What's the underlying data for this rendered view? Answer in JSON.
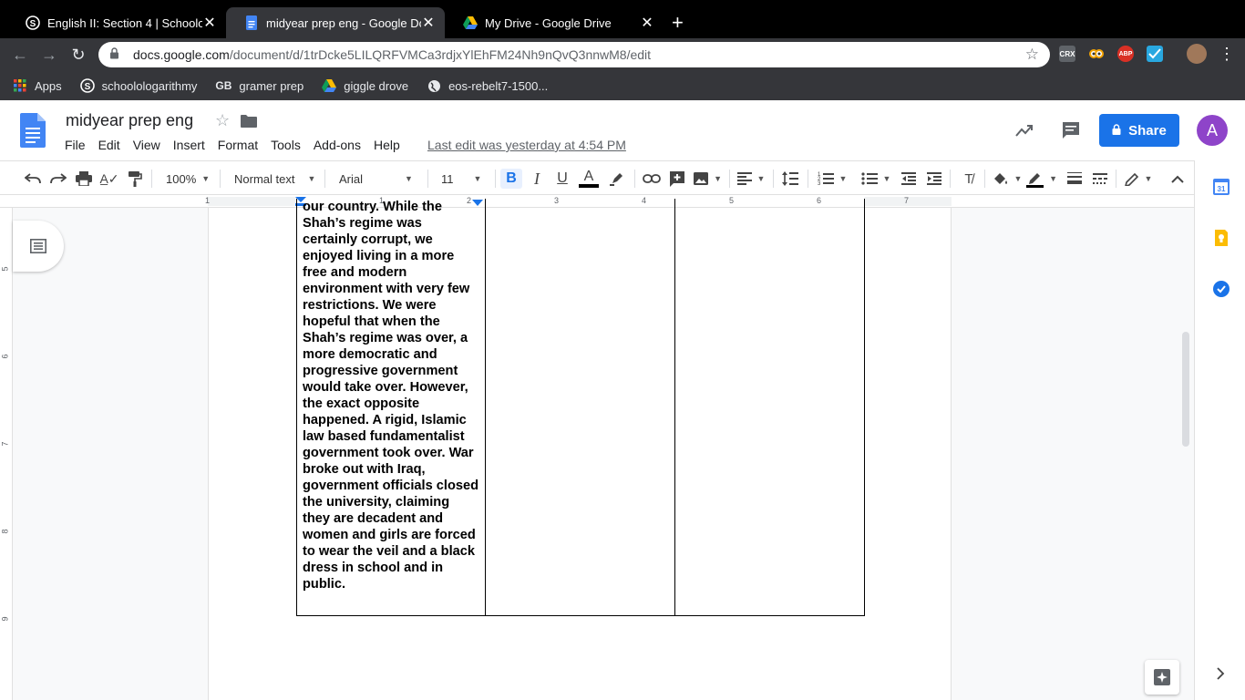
{
  "browser": {
    "tabs": [
      {
        "title": "English II: Section 4 | Schoology"
      },
      {
        "title": "midyear prep eng - Google Docs"
      },
      {
        "title": "My Drive - Google Drive"
      }
    ],
    "url_host": "docs.google.com",
    "url_path": "/document/d/1trDcke5LILQRFVMCa3rdjxYlEhFM24Nh9nQvQ3nnwM8/edit",
    "extensions": [
      "CRX",
      "ABP"
    ],
    "bookmarks": [
      {
        "label": "Apps"
      },
      {
        "label": "schoolologarithmy"
      },
      {
        "label": "gramer prep"
      },
      {
        "label": "giggle drove"
      },
      {
        "label": "eos-rebelt7-1500..."
      }
    ]
  },
  "docs": {
    "title": "midyear prep eng",
    "menu": [
      "File",
      "Edit",
      "View",
      "Insert",
      "Format",
      "Tools",
      "Add-ons",
      "Help"
    ],
    "last_edit": "Last edit was yesterday at 4:54 PM",
    "share_label": "Share",
    "avatar_letter": "A"
  },
  "toolbar": {
    "zoom": "100%",
    "style": "Normal text",
    "font": "Arial",
    "size": "11",
    "bold": "B",
    "italic": "I",
    "underline": "U",
    "text_color": "A"
  },
  "ruler": {
    "numbers": [
      "1",
      "1",
      "2",
      "3",
      "4",
      "5",
      "6",
      "7"
    ],
    "vertical_numbers": [
      "5",
      "6",
      "7",
      "8",
      "9"
    ]
  },
  "document": {
    "cell_text": "our country. While the Shah’s regime was certainly corrupt, we enjoyed living in a more free and modern environment with very few restrictions. We were hopeful that when the Shah’s regime was over, a more democratic and progressive government would take over. However, the exact opposite happened. A rigid, Islamic law based fundamentalist government took over. War broke out with Iraq, government officials closed the university, claiming they are decadent and women and girls are forced to wear the veil and a black dress in school and in public."
  },
  "colors": {
    "accent": "#1a73e8",
    "chrome_dark": "#35363a",
    "avatar": "#8e44c9"
  }
}
